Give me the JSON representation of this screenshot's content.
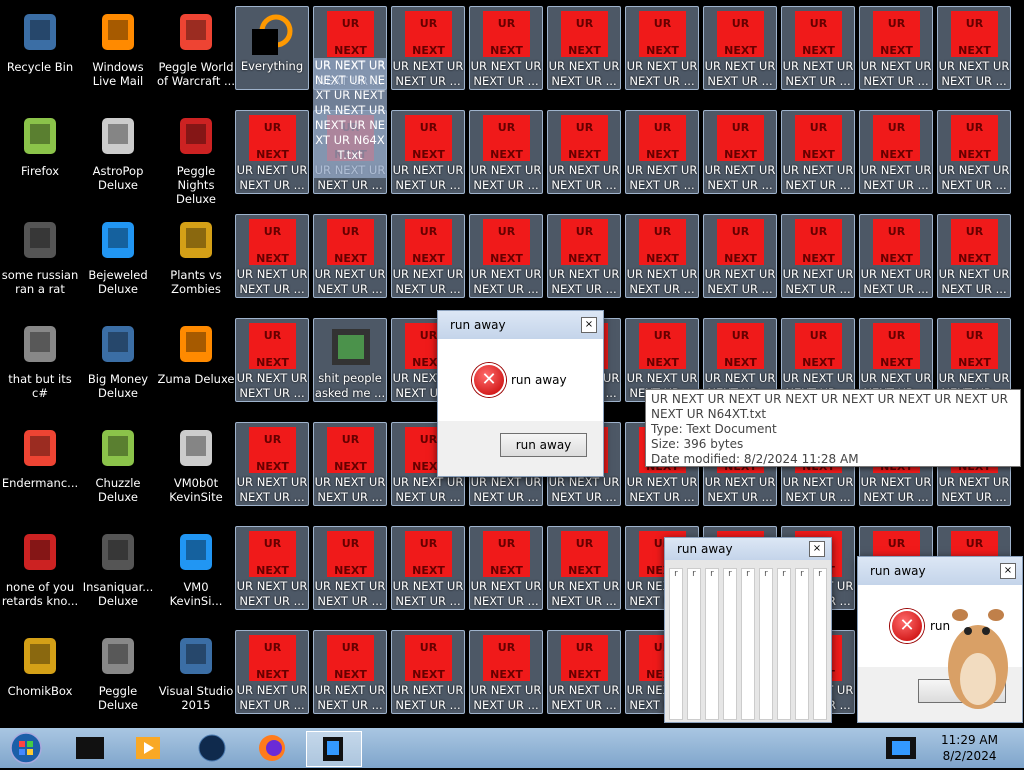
{
  "desktop_icons": [
    {
      "label": "Recycle Bin",
      "icon": "recycle-bin-icon"
    },
    {
      "label": "Windows Live Mail",
      "icon": "mail-icon"
    },
    {
      "label": "Peggle World of Warcraft ...",
      "icon": "peggle-icon"
    },
    {
      "label": "Firefox",
      "icon": "firefox-icon"
    },
    {
      "label": "AstroPop Deluxe",
      "icon": "game-icon"
    },
    {
      "label": "Peggle Nights Deluxe",
      "icon": "peggle-icon"
    },
    {
      "label": "some russian ran a rat",
      "icon": "document-icon"
    },
    {
      "label": "Bejeweled Deluxe",
      "icon": "gem-icon"
    },
    {
      "label": "Plants vs Zombies",
      "icon": "plant-icon"
    },
    {
      "label": "that but its c#",
      "icon": "window-icon"
    },
    {
      "label": "Big Money Deluxe",
      "icon": "game-icon"
    },
    {
      "label": "Zuma Deluxe",
      "icon": "game-icon"
    },
    {
      "label": "Endermanc...",
      "icon": "app-icon"
    },
    {
      "label": "Chuzzle Deluxe",
      "icon": "game-icon"
    },
    {
      "label": "VM0b0t KevinSite",
      "icon": "app-icon"
    },
    {
      "label": "none of you retards kno...",
      "icon": "app-icon"
    },
    {
      "label": "Insaniquar... Deluxe",
      "icon": "fish-icon"
    },
    {
      "label": "VM0 KevinSi...",
      "icon": "app-icon"
    },
    {
      "label": "ChomikBox",
      "icon": "hamster-icon"
    },
    {
      "label": "Peggle Deluxe",
      "icon": "peggle-icon"
    },
    {
      "label": "Visual Studio 2015",
      "icon": "visual-studio-icon"
    }
  ],
  "everything_label": "Everything",
  "file_tile": {
    "thumb_top": "UR",
    "thumb_bottom": "NEXT",
    "caption": "UR NEXT UR NEXT UR ..."
  },
  "expanded_caption": "UR NEXT UR NEXT UR NEXT UR NEXT UR NEXT UR NEXT UR NEXT UR N64XT.txt",
  "shit_people_label": "shit people asked me ...",
  "tooltip": {
    "name": "UR NEXT UR NEXT UR NEXT UR NEXT UR NEXT UR NEXT UR NEXT UR N64XT.txt",
    "type": "Type: Text Document",
    "size": "Size: 396 bytes",
    "modified": "Date modified: 8/2/2024 11:28 AM"
  },
  "dialog_main": {
    "title": "run away",
    "message": "run away",
    "button": "run away",
    "close": "×"
  },
  "dialog_back": {
    "title": "run away",
    "close": "×",
    "letter": "r"
  },
  "dialog_front": {
    "title": "run away",
    "message": "run",
    "close": "×",
    "button": "ru"
  },
  "taskbar": {
    "time": "11:29 AM",
    "date": "8/2/2024"
  },
  "colors": {
    "tile_red": "#f01a1a",
    "taskbar": "#8fb3d6"
  }
}
